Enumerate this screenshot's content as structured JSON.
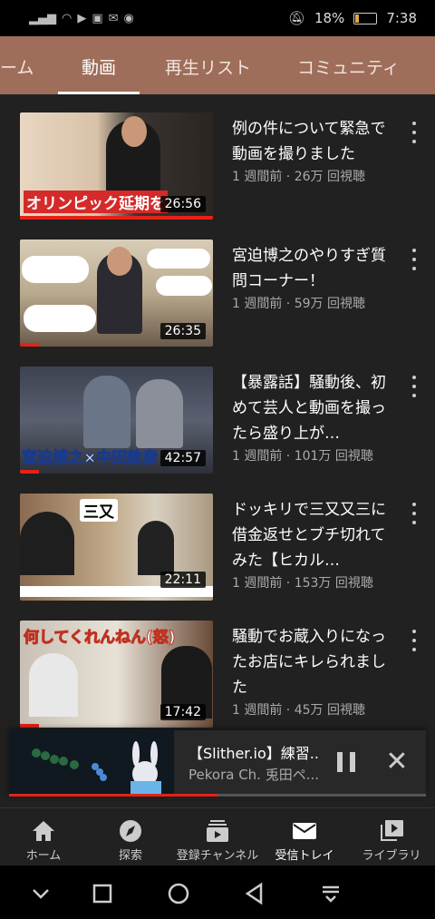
{
  "status_bar": {
    "battery": "18%",
    "time": "7:38",
    "battery_level": 0.18
  },
  "tabs": [
    {
      "label": "ーム",
      "active": false
    },
    {
      "label": "動画",
      "active": true
    },
    {
      "label": "再生リスト",
      "active": false
    },
    {
      "label": "コミュニティ",
      "active": false
    }
  ],
  "videos": [
    {
      "title": "例の件について緊急で動画を撮りました",
      "meta": "1 週間前 · 26万 回視聴",
      "duration": "26:56",
      "overlay": "オリンピック延期を",
      "watched": 1.0
    },
    {
      "title": "宮迫博之のやりすぎ質問コーナー！",
      "meta": "1 週間前 · 59万 回視聴",
      "duration": "26:35",
      "overlay": "",
      "watched": 0.1
    },
    {
      "title": "【暴露話】騒動後、初めて芸人と動画を撮ったら盛り上が…",
      "meta": "1 週間前 · 101万 回視聴",
      "duration": "42:57",
      "overlay": "宮迫博之×中田敦彦",
      "watched": 0.1
    },
    {
      "title": "ドッキリで三又又三に借金返せとブチ切れてみた【ヒカル…",
      "meta": "1 週間前 · 153万 回視聴",
      "duration": "22:11",
      "overlay": "三又",
      "watched": 0.0
    },
    {
      "title": "騒動でお蔵入りになったお店にキレられました",
      "meta": "1 週間前 · 45万 回視聴",
      "duration": "17:42",
      "overlay": "何してくれんねん(怒)",
      "watched": 0.1
    }
  ],
  "mini_player": {
    "title": "【Slither.io】練習..",
    "channel": "Pekora Ch. 兎田ペ...",
    "progress": 0.5
  },
  "bottom_nav": [
    {
      "label": "ホーム",
      "icon": "home-icon",
      "active": false
    },
    {
      "label": "探索",
      "icon": "explore-icon",
      "active": false
    },
    {
      "label": "登録チャンネル",
      "icon": "subscriptions-icon",
      "active": false
    },
    {
      "label": "受信トレイ",
      "icon": "inbox-icon",
      "active": true
    },
    {
      "label": "ライブラリ",
      "icon": "library-icon",
      "active": false
    }
  ],
  "colors": {
    "tabbar": "#9e6e5a",
    "accent_red": "#e62117",
    "background": "#212121"
  }
}
